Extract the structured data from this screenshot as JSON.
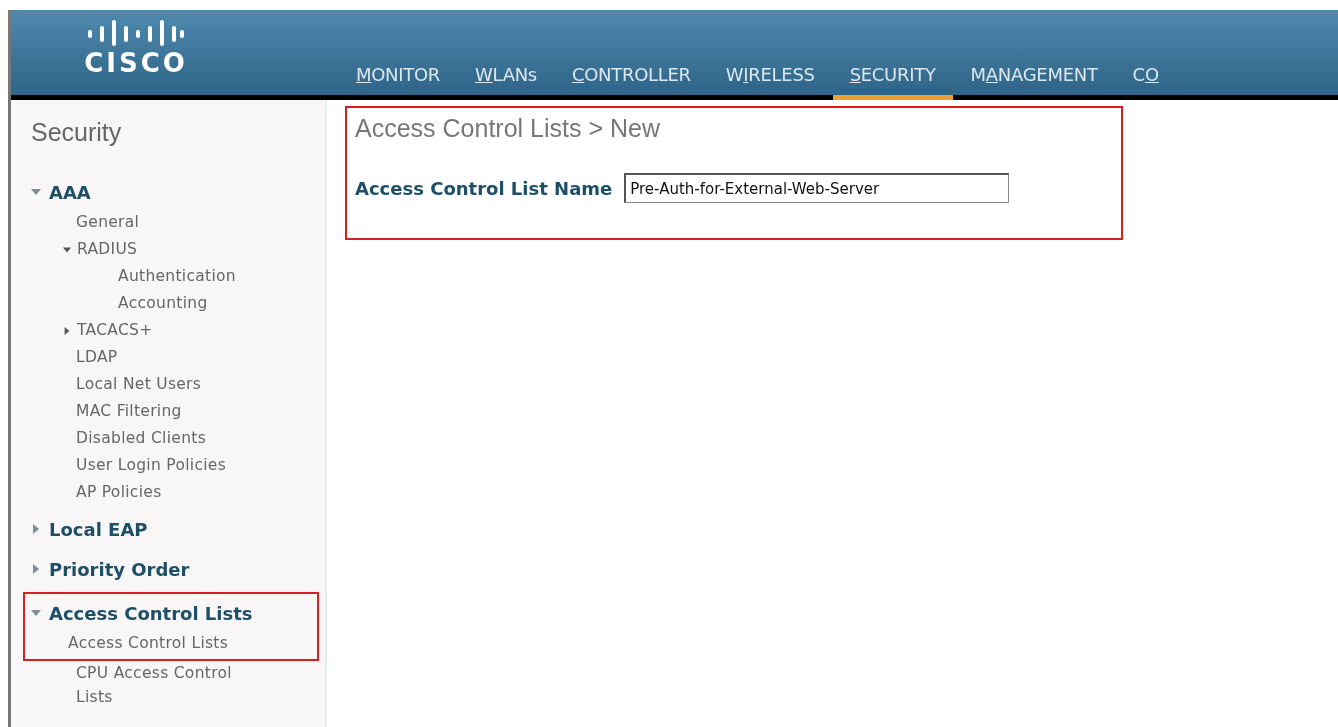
{
  "header": {
    "logo": "CISCO",
    "tabs": [
      {
        "key": "M",
        "post": "ONITOR",
        "selected": false
      },
      {
        "key": "W",
        "post": "LANs",
        "selected": false
      },
      {
        "key": "C",
        "post": "ONTROLLER",
        "selected": false
      },
      {
        "pre": "W",
        "key": "I",
        "post": "RELESS",
        "selected": false
      },
      {
        "key": "S",
        "post": "ECURITY",
        "selected": true
      },
      {
        "pre": "M",
        "key": "A",
        "post": "NAGEMENT",
        "selected": false
      },
      {
        "pre": "C",
        "key": "O",
        "selected": false
      }
    ]
  },
  "sidebar": {
    "title": "Security",
    "sections": [
      {
        "label": "AAA",
        "expanded": true,
        "highlighted": false,
        "children": [
          {
            "label": "General",
            "highlighted": false
          },
          {
            "label": "RADIUS",
            "expanded": true,
            "highlighted": false,
            "children": [
              {
                "label": "Authentication"
              },
              {
                "label": "Accounting"
              }
            ]
          },
          {
            "label": "TACACS+",
            "expanded": false,
            "highlighted": false
          },
          {
            "label": "LDAP",
            "highlighted": false
          },
          {
            "label": "Local Net Users",
            "highlighted": false
          },
          {
            "label": "MAC Filtering",
            "highlighted": false
          },
          {
            "label": "Disabled Clients",
            "highlighted": false
          },
          {
            "label": "User Login Policies",
            "highlighted": false
          },
          {
            "label": "AP Policies",
            "highlighted": false
          }
        ]
      },
      {
        "label": "Local EAP",
        "expanded": false,
        "highlighted": false
      },
      {
        "label": "Priority Order",
        "expanded": false,
        "highlighted": false
      },
      {
        "label": "Access Control Lists",
        "expanded": true,
        "highlighted": true,
        "children": [
          {
            "label": "Access Control Lists",
            "highlighted": true
          },
          {
            "label": "CPU Access Control Lists",
            "highlighted": false
          }
        ]
      }
    ]
  },
  "main": {
    "title": "Access Control Lists > New",
    "highlighted": true,
    "field": {
      "label": "Access Control List Name",
      "value": "Pre-Auth-for-External-Web-Server"
    }
  }
}
